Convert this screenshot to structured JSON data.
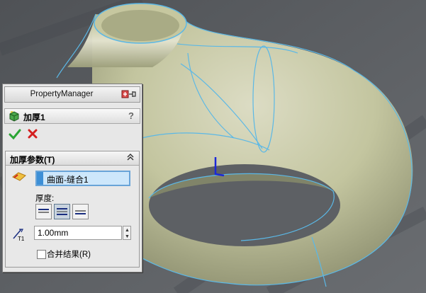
{
  "panel": {
    "title": "PropertyManager",
    "feature_name": "加厚1",
    "help_label": "?"
  },
  "group": {
    "title": "加厚参数(T)",
    "selection": "曲面-缝合1",
    "thickness_label": "厚度:",
    "thickness_value": "1.00mm",
    "merge_label": "合并结果(R)",
    "merge_checked": false
  },
  "icons": {
    "pin": "pushpin-icon",
    "feature": "thicken-feature-icon",
    "ok": "checkmark-icon",
    "cancel": "x-icon",
    "collapse": "double-chevron-up-icon",
    "selection": "face-selection-icon",
    "thickness": "thickness-dimension-icon"
  },
  "colors": {
    "accent": "#3d8fd6",
    "ok": "#2aa534",
    "cancel": "#d42020",
    "model_edges": "#5bb8e6",
    "model_surface": "#c5c8a2"
  }
}
